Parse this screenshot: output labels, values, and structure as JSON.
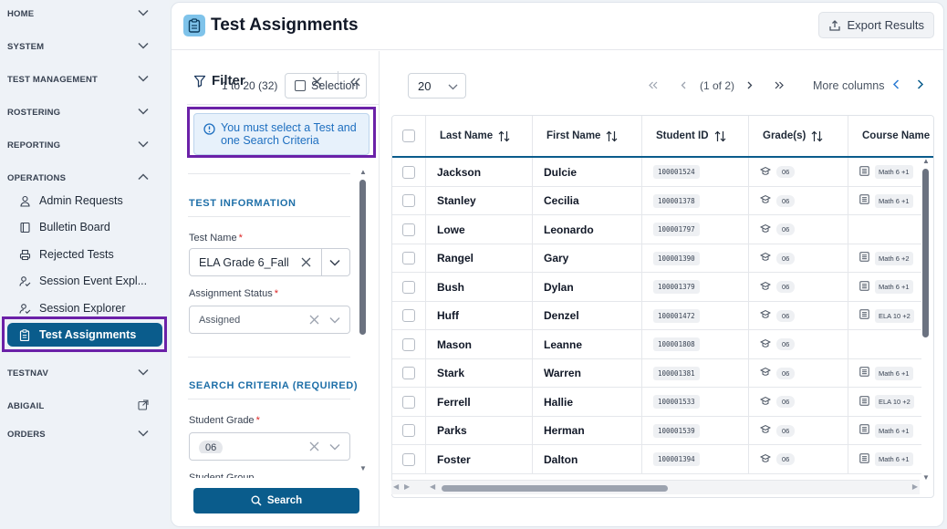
{
  "sidebar": {
    "sections": [
      {
        "label": "HOME",
        "expanded": false
      },
      {
        "label": "SYSTEM",
        "expanded": false
      },
      {
        "label": "TEST MANAGEMENT",
        "expanded": false
      },
      {
        "label": "ROSTERING",
        "expanded": false
      },
      {
        "label": "REPORTING",
        "expanded": false
      },
      {
        "label": "OPERATIONS",
        "expanded": true
      },
      {
        "label": "TESTNAV",
        "expanded": false
      },
      {
        "label": "ABIGAIL",
        "external": true
      },
      {
        "label": "ORDERS",
        "expanded": false
      }
    ],
    "operations_items": [
      {
        "label": "Admin Requests",
        "icon": "user-request-icon"
      },
      {
        "label": "Bulletin Board",
        "icon": "book-icon"
      },
      {
        "label": "Rejected Tests",
        "icon": "printer-icon"
      },
      {
        "label": "Session Event Expl...",
        "icon": "user-check-icon"
      },
      {
        "label": "Session Explorer",
        "icon": "user-check-icon"
      },
      {
        "label": "Test Assignments",
        "icon": "clipboard-icon",
        "active": true
      }
    ]
  },
  "header": {
    "title": "Test Assignments",
    "export_label": "Export Results"
  },
  "filter": {
    "title": "Filter",
    "notice": "You must select a Test and one Search Criteria",
    "test_info_title": "TEST INFORMATION",
    "test_name_label": "Test Name",
    "test_name_value": "ELA Grade 6_Fall",
    "assignment_status_label": "Assignment Status",
    "assignment_status_value": "Assigned",
    "search_criteria_title": "SEARCH CRITERIA (REQUIRED)",
    "student_grade_label": "Student Grade",
    "student_grade_value": "06",
    "next_label": "Student Group",
    "search_label": "Search"
  },
  "toolbar": {
    "range": "1 to 20 (32)",
    "selection_label": "Selection",
    "page_size": "20",
    "page_info": "(1 of 2)",
    "more_columns": "More columns"
  },
  "table": {
    "columns": [
      "Last Name",
      "First Name",
      "Student ID",
      "Grade(s)",
      "Course Name"
    ],
    "rows": [
      {
        "last": "Jackson",
        "first": "Dulcie",
        "id": "100001524",
        "grade": "06",
        "course": "Math 6 +1"
      },
      {
        "last": "Stanley",
        "first": "Cecilia",
        "id": "100001378",
        "grade": "06",
        "course": "Math 6 +1"
      },
      {
        "last": "Lowe",
        "first": "Leonardo",
        "id": "100001797",
        "grade": "06",
        "course": ""
      },
      {
        "last": "Rangel",
        "first": "Gary",
        "id": "100001390",
        "grade": "06",
        "course": "Math 6 +2"
      },
      {
        "last": "Bush",
        "first": "Dylan",
        "id": "100001379",
        "grade": "06",
        "course": "Math 6 +1"
      },
      {
        "last": "Huff",
        "first": "Denzel",
        "id": "100001472",
        "grade": "06",
        "course": "ELA 10 +2"
      },
      {
        "last": "Mason",
        "first": "Leanne",
        "id": "100001808",
        "grade": "06",
        "course": ""
      },
      {
        "last": "Stark",
        "first": "Warren",
        "id": "100001381",
        "grade": "06",
        "course": "Math 6 +1"
      },
      {
        "last": "Ferrell",
        "first": "Hallie",
        "id": "100001533",
        "grade": "06",
        "course": "ELA 10 +2"
      },
      {
        "last": "Parks",
        "first": "Herman",
        "id": "100001539",
        "grade": "06",
        "course": "Math 6 +1"
      },
      {
        "last": "Foster",
        "first": "Dalton",
        "id": "100001394",
        "grade": "06",
        "course": "Math 6 +1"
      }
    ]
  },
  "colors": {
    "accent": "#0a5c8c",
    "highlight": "#6b21a8",
    "notice": "#1e6fc0"
  }
}
